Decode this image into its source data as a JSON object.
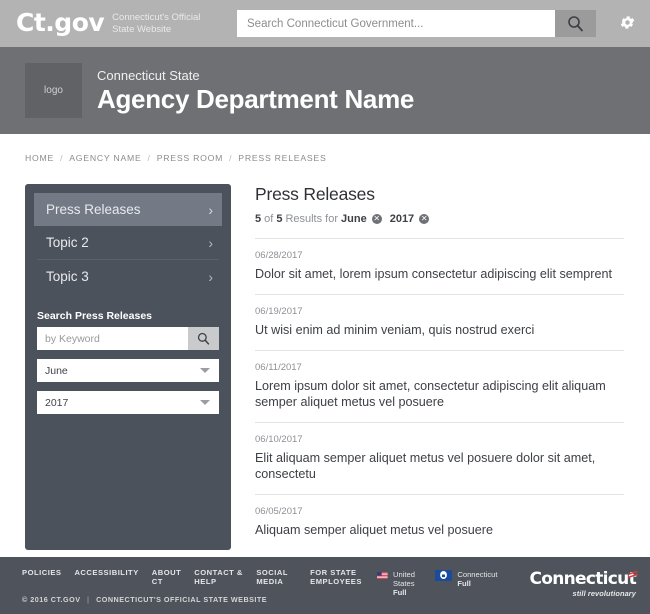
{
  "topbar": {
    "logo_text": "Ct.gov",
    "tagline": "Connecticut's Official State Website",
    "search_placeholder": "Search Connecticut Government...",
    "search_value": "",
    "search_icon": "search-icon",
    "settings_icon": "gear-icon"
  },
  "agency": {
    "logo_placeholder": "logo",
    "subtitle": "Connecticut State",
    "title": "Agency Department Name"
  },
  "breadcrumb": {
    "items": [
      "HOME",
      "AGENCY NAME",
      "PRESS ROOM",
      "PRESS RELEASES"
    ],
    "separator": "/"
  },
  "sidebar": {
    "nav": [
      {
        "label": "Press Releases",
        "active": true
      },
      {
        "label": "Topic 2",
        "active": false
      },
      {
        "label": "Topic 3",
        "active": false
      }
    ],
    "search_label": "Search Press Releases",
    "keyword_placeholder": "by Keyword",
    "keyword_value": "",
    "month_select": "June",
    "year_select": "2017"
  },
  "main": {
    "title": "Press Releases",
    "results_count": "5",
    "results_total": "5",
    "results_of": "of",
    "results_for": "Results for",
    "filters": [
      {
        "label": "June"
      },
      {
        "label": "2017"
      }
    ],
    "results": [
      {
        "date": "06/28/2017",
        "title": "Dolor sit amet, lorem ipsum consectetur adipiscing elit semprent"
      },
      {
        "date": "06/19/2017",
        "title": "Ut wisi enim ad minim veniam, quis nostrud exerci"
      },
      {
        "date": "06/11/2017",
        "title": "Lorem ipsum dolor sit amet, consectetur adipiscing elit aliquam semper aliquet metus vel posuere"
      },
      {
        "date": "06/10/2017",
        "title": "Elit aliquam semper aliquet metus vel posuere dolor sit amet, consectetu"
      },
      {
        "date": "06/05/2017",
        "title": "Aliquam semper aliquet metus vel posuere"
      }
    ]
  },
  "footer": {
    "links": [
      "POLICIES",
      "ACCESSIBILITY",
      "ABOUT CT",
      "CONTACT & HELP",
      "SOCIAL MEDIA",
      "FOR STATE EMPLOYEES"
    ],
    "copyright": "© 2016 CT.GOV",
    "copyright_site": "CONNECTICUT'S OFFICIAL STATE WEBSITE",
    "flags": [
      {
        "name": "United States",
        "status": "Full"
      },
      {
        "name": "Connecticut",
        "status": "Full"
      }
    ],
    "logo_main": "Connecticut",
    "logo_sub": "still revolutionary"
  },
  "colors": {
    "topbar_bg": "#b3b3b3",
    "agency_bg": "#6f7073",
    "sidebar_bg": "#4c525c",
    "sidebar_active": "#737a85",
    "footer_bg": "#4f545c",
    "text_dark": "#3d4046",
    "text_muted": "#8d9095"
  }
}
